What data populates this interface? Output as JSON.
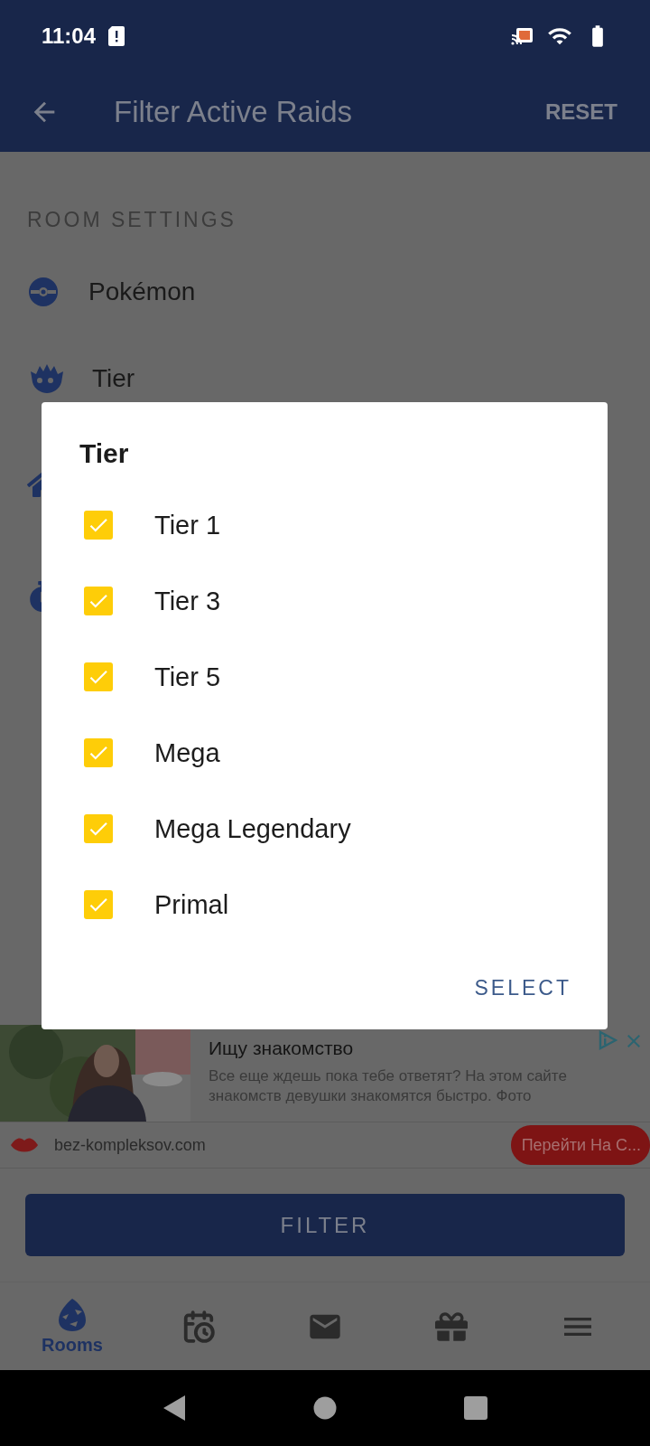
{
  "status_bar": {
    "time": "11:04"
  },
  "app_bar": {
    "title": "Filter Active Raids",
    "action": "RESET"
  },
  "room_settings": {
    "heading": "ROOM SETTINGS",
    "items": [
      {
        "label": "Pokémon"
      },
      {
        "label": "Tier"
      }
    ]
  },
  "dialog": {
    "title": "Tier",
    "options": [
      {
        "label": "Tier 1",
        "checked": true
      },
      {
        "label": "Tier 3",
        "checked": true
      },
      {
        "label": "Tier 5",
        "checked": true
      },
      {
        "label": "Mega",
        "checked": true
      },
      {
        "label": "Mega Legendary",
        "checked": true
      },
      {
        "label": "Primal",
        "checked": true
      }
    ],
    "action": "SELECT"
  },
  "ad": {
    "title": "Ищу знакомство",
    "text": "Все еще ждешь пока тебе ответят? На этом сайте знакомств девушки знакомятся быстро. Фото",
    "domain": "bez-kompleksov.com",
    "cta": "Перейти На С..."
  },
  "filter_button": "FILTER",
  "bottom_nav": [
    {
      "label": "Rooms",
      "selected": true
    },
    {
      "selected": false
    },
    {
      "selected": false
    },
    {
      "selected": false
    },
    {
      "selected": false
    }
  ]
}
